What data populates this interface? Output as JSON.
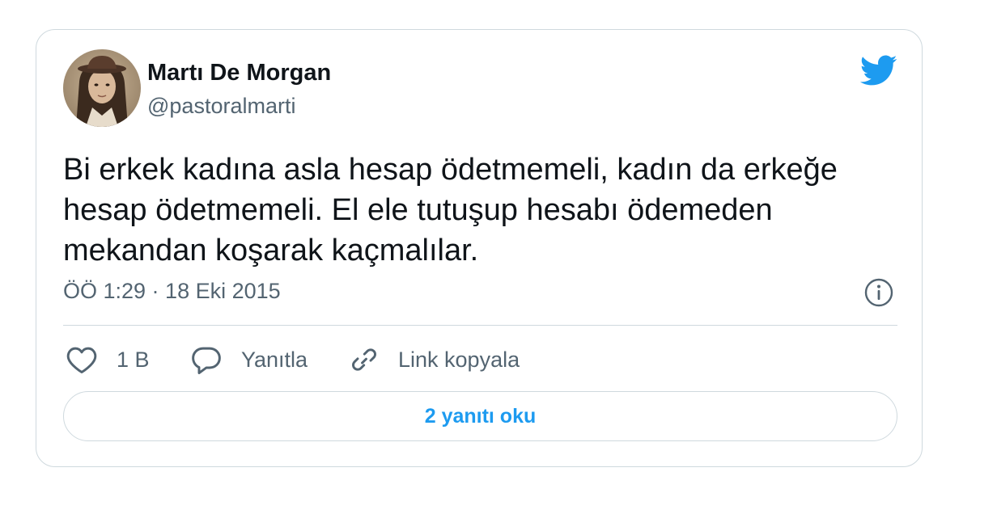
{
  "author": {
    "name": "Martı De Morgan",
    "handle": "@pastoralmarti",
    "avatar_alt": "avatar"
  },
  "tweet": {
    "lines": [
      "Bi erkek kadına asla hesap ödetmemeli, kadın da erkeğe",
      "hesap ödetmemeli. El ele tutuşup hesabı ödemeden",
      "mekandan koşarak kaçmalılar."
    ]
  },
  "meta": {
    "timestamp": "ÖÖ 1:29 · 18 Eki 2015"
  },
  "actions": {
    "like_count": "1 B",
    "reply_label": "Yanıtla",
    "copy_label": "Link kopyala"
  },
  "replies_button": {
    "label": "2 yanıtı oku"
  },
  "icons": {
    "brand": "twitter-bird-icon",
    "info": "info-icon",
    "like": "heart-icon",
    "reply": "speech-bubble-icon",
    "copy": "link-icon"
  },
  "colors": {
    "brand": "#1d9bf0",
    "text": "#0f1419",
    "secondary": "#536471",
    "border": "#cfd9de"
  }
}
